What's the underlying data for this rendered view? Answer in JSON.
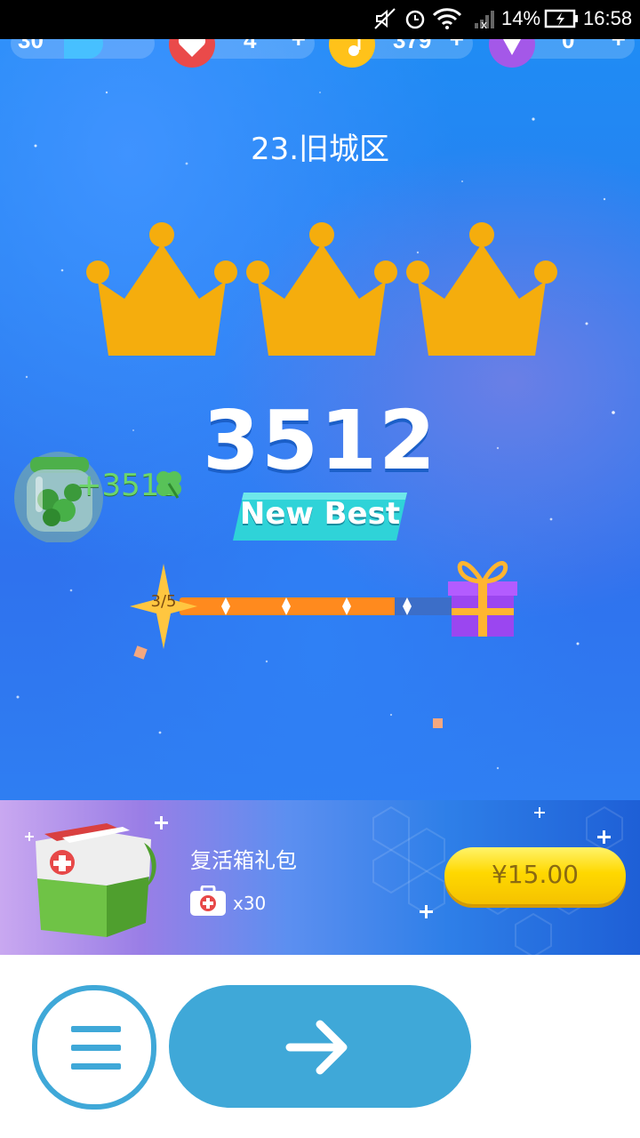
{
  "status_bar": {
    "battery": "14%",
    "time": "16:58"
  },
  "currency_bar": {
    "level_value": "30",
    "lives_value": "4",
    "notes_value": "379",
    "gems_value": "0",
    "plus": "+"
  },
  "level": {
    "title": "23.旧城区",
    "crowns_earned": 3,
    "crowns_total": 3
  },
  "result": {
    "score": "3512",
    "badge": "New Best"
  },
  "clover_jar": {
    "gain": "+3512"
  },
  "reward_progress": {
    "count": "3/5",
    "current": 3,
    "total": 5
  },
  "offer": {
    "title": "复活箱礼包",
    "quantity": "x30",
    "price": "¥15.00"
  },
  "colors": {
    "accent": "#3fa8d8",
    "crown": "#f5ad0d",
    "progress_fill": "#ff8a1e",
    "price_button": "#ffd800"
  }
}
